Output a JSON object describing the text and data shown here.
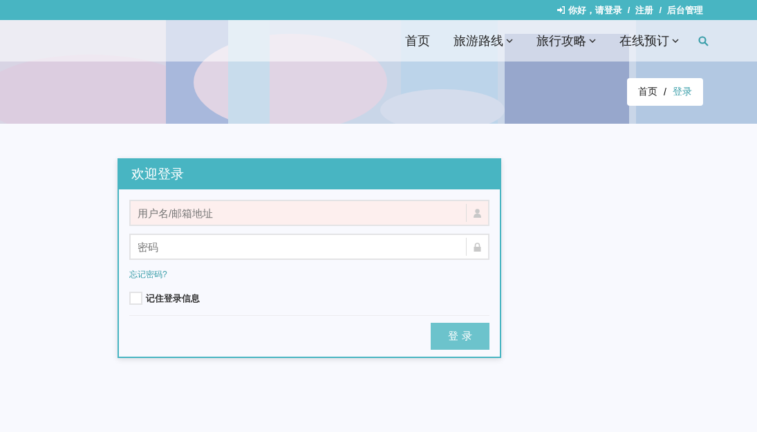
{
  "top_bar": {
    "links": [
      {
        "label": "你好，请登录",
        "icon": true
      },
      {
        "label": "注册"
      },
      {
        "label": "后台管理"
      }
    ],
    "separator": "/"
  },
  "nav": {
    "items": [
      {
        "label": "首页",
        "dropdown": false
      },
      {
        "label": "旅游路线",
        "dropdown": true
      },
      {
        "label": "旅行攻略",
        "dropdown": true
      },
      {
        "label": "在线预订",
        "dropdown": true
      }
    ]
  },
  "breadcrumb": {
    "items": [
      {
        "label": "首页",
        "selected": false
      },
      {
        "label": "登录",
        "selected": true
      }
    ],
    "separator": "/"
  },
  "login": {
    "title": "欢迎登录",
    "fields": [
      {
        "placeholder": "用户名/邮箱地址",
        "kind": "user",
        "highlighted": true
      },
      {
        "placeholder": "密码",
        "kind": "password",
        "highlighted": false
      }
    ],
    "forgot": "忘记密码?",
    "remember": {
      "label": "记住登录信息",
      "checked": false
    },
    "submit": "登 录"
  }
}
